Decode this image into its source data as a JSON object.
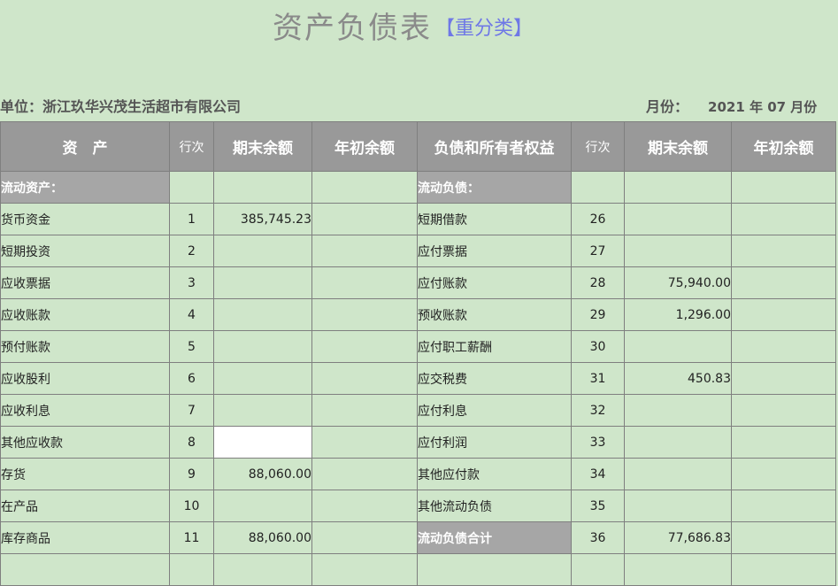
{
  "header": {
    "title": "资产负债表",
    "subtitle": "【重分类】",
    "unit_label": "单位：浙江玖华兴茂生活超市有限公司",
    "period_label": "月份：",
    "period_value": "2021 年 07 月份"
  },
  "columns": {
    "asset": "资　产",
    "line_no": "行次",
    "end_balance": "期末余额",
    "begin_balance": "年初余额",
    "liability": "负债和所有者权益"
  },
  "rows": [
    {
      "a_name": "流动资产：",
      "a_line": "",
      "a_end": "",
      "a_begin": "",
      "l_name": "流动负债：",
      "l_line": "",
      "l_end": "",
      "l_begin": ""
    },
    {
      "a_name": "货币资金",
      "a_line": "1",
      "a_end": "385,745.23",
      "a_begin": "",
      "l_name": "短期借款",
      "l_line": "26",
      "l_end": "",
      "l_begin": ""
    },
    {
      "a_name": "短期投资",
      "a_line": "2",
      "a_end": "",
      "a_begin": "",
      "l_name": "应付票据",
      "l_line": "27",
      "l_end": "",
      "l_begin": ""
    },
    {
      "a_name": "应收票据",
      "a_line": "3",
      "a_end": "",
      "a_begin": "",
      "l_name": "应付账款",
      "l_line": "28",
      "l_end": "75,940.00",
      "l_begin": ""
    },
    {
      "a_name": "应收账款",
      "a_line": "4",
      "a_end": "",
      "a_begin": "",
      "l_name": "预收账款",
      "l_line": "29",
      "l_end": "1,296.00",
      "l_begin": ""
    },
    {
      "a_name": "预付账款",
      "a_line": "5",
      "a_end": "",
      "a_begin": "",
      "l_name": "应付职工薪酬",
      "l_line": "30",
      "l_end": "",
      "l_begin": ""
    },
    {
      "a_name": "应收股利",
      "a_line": "6",
      "a_end": "",
      "a_begin": "",
      "l_name": "应交税费",
      "l_line": "31",
      "l_end": "450.83",
      "l_begin": ""
    },
    {
      "a_name": "应收利息",
      "a_line": "7",
      "a_end": "",
      "a_begin": "",
      "l_name": "应付利息",
      "l_line": "32",
      "l_end": "",
      "l_begin": ""
    },
    {
      "a_name": "其他应收款",
      "a_line": "8",
      "a_end": "",
      "a_begin": "",
      "l_name": "应付利润",
      "l_line": "33",
      "l_end": "",
      "l_begin": ""
    },
    {
      "a_name": "存货",
      "a_line": "9",
      "a_end": "88,060.00",
      "a_begin": "",
      "l_name": "其他应付款",
      "l_line": "34",
      "l_end": "",
      "l_begin": ""
    },
    {
      "a_name": "在产品",
      "a_line": "10",
      "a_end": "",
      "a_begin": "",
      "l_name": "其他流动负债",
      "l_line": "35",
      "l_end": "",
      "l_begin": ""
    },
    {
      "a_name": "库存商品",
      "a_line": "11",
      "a_end": "88,060.00",
      "a_begin": "",
      "l_name": "流动负债合计",
      "l_line": "36",
      "l_end": "77,686.83",
      "l_begin": ""
    },
    {
      "a_name": "",
      "a_line": "",
      "a_end": "",
      "a_begin": "",
      "l_name": "",
      "l_line": "",
      "l_end": "",
      "l_begin": ""
    }
  ]
}
